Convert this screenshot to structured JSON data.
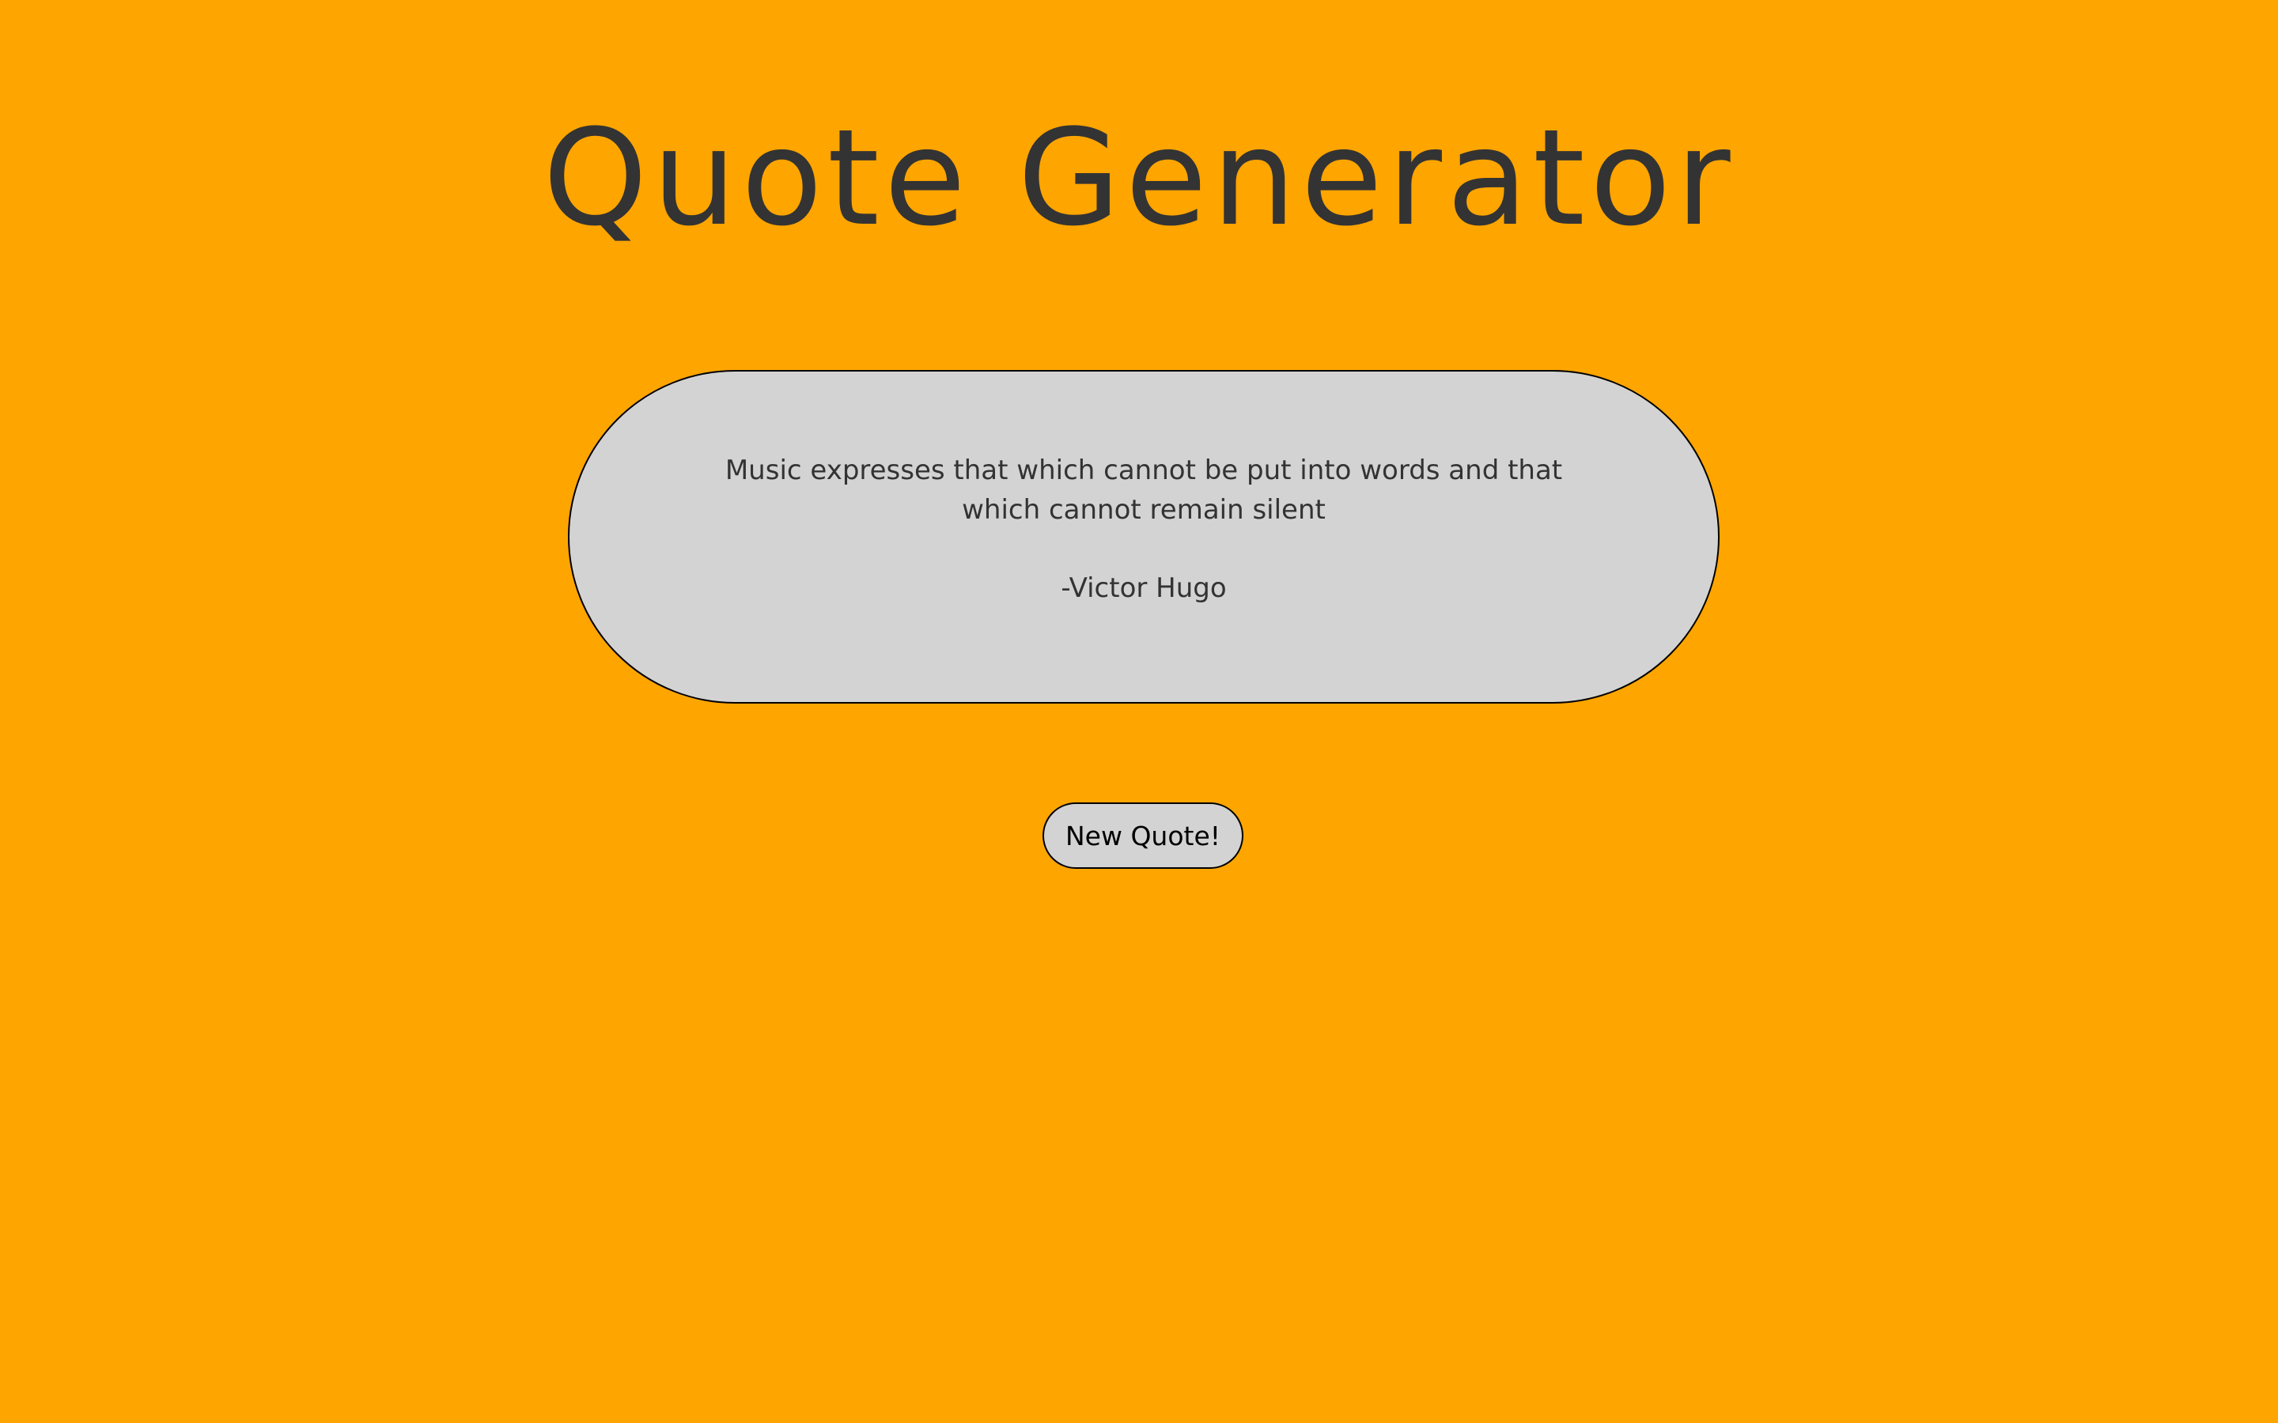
{
  "header": {
    "title": "Quote Generator"
  },
  "quote": {
    "text": "Music expresses that which cannot be put into words and that which cannot remain silent",
    "author": "-Victor Hugo"
  },
  "actions": {
    "new_quote_label": "New Quote!"
  },
  "colors": {
    "background": "#FFA500",
    "card": "#D3D3D3",
    "text": "#333333"
  }
}
